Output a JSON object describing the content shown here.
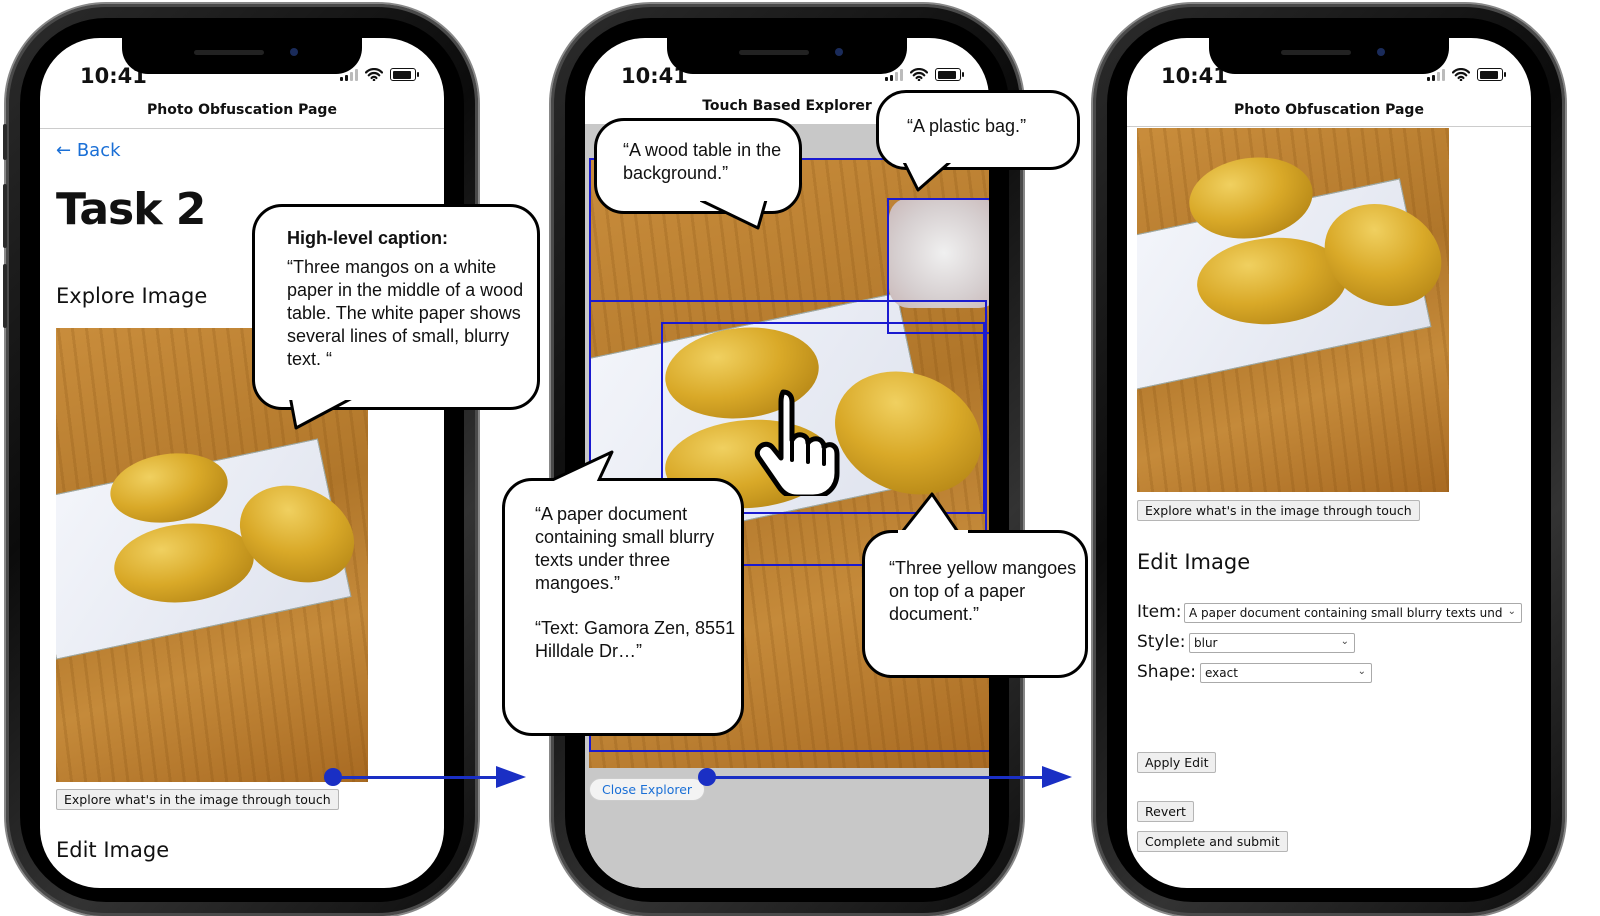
{
  "colors": {
    "flow_accent": "#1a2fc4",
    "bbox": "#1a1ad0",
    "link": "#1a6fd6"
  },
  "phone1": {
    "time": "10:41",
    "title": "Photo Obfuscation Page",
    "back": "Back",
    "heading": "Task 2",
    "section": "Explore Image",
    "explore_button": "Explore what's in the image through touch",
    "edit_heading": "Edit Image"
  },
  "phone2": {
    "time": "10:41",
    "title": "Touch Based Explorer",
    "close_button": "Close Explorer"
  },
  "phone3": {
    "time": "10:41",
    "title": "Photo Obfuscation Page",
    "explore_button": "Explore what's in the image through touch",
    "edit_heading": "Edit Image",
    "item_label": "Item:",
    "item_value": "A paper document containing small blurry texts und",
    "style_label": "Style:",
    "style_value": "blur",
    "shape_label": "Shape:",
    "shape_value": "exact",
    "apply_button": "Apply Edit",
    "revert_button": "Revert",
    "submit_button": "Complete and submit"
  },
  "callouts": {
    "caption_title": "High-level caption:",
    "caption_body": "“Three mangos on a white paper in the middle of a wood table. The white paper shows several lines of small, blurry text. “",
    "wood_table": "“A wood table in the background.”",
    "plastic_bag": "“A plastic bag.”",
    "paper_doc": "“A paper document containing small blurry texts under three mangoes.”",
    "paper_text": "“Text: Gamora Zen, 8551 Hilldale Dr…”",
    "mangoes": "“Three yellow mangoes on top of a paper document.”"
  },
  "icons": [
    "back-arrow-icon",
    "signal-icon",
    "wifi-icon",
    "battery-icon",
    "hand-pointer-icon",
    "chevron-down-icon"
  ]
}
